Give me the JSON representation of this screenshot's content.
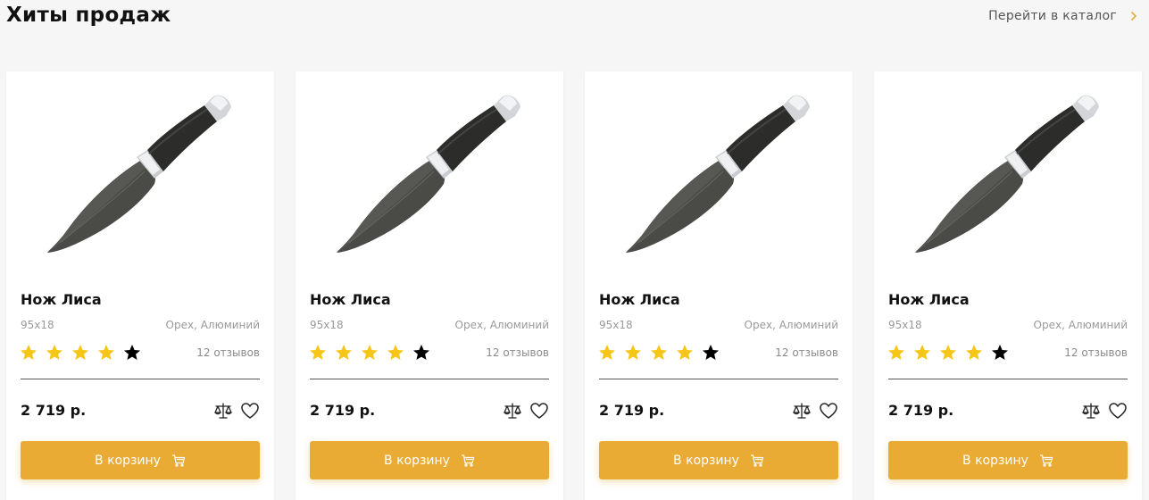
{
  "header": {
    "title": "Хиты продаж",
    "catalog_link": "Перейти в каталог"
  },
  "colors": {
    "accent": "#e9ab33",
    "star_filled": "#f5c518",
    "star_empty": "#000000"
  },
  "products": [
    {
      "name": "Нож Лиса",
      "size": "95х18",
      "material": "Орех, Алюминий",
      "rating": 4,
      "rating_max": 5,
      "reviews": "12 отзывов",
      "price": "2 719 р.",
      "button": "В корзину"
    },
    {
      "name": "Нож Лиса",
      "size": "95х18",
      "material": "Орех, Алюминий",
      "rating": 4,
      "rating_max": 5,
      "reviews": "12 отзывов",
      "price": "2 719 р.",
      "button": "В корзину"
    },
    {
      "name": "Нож Лиса",
      "size": "95х18",
      "material": "Орех, Алюминий",
      "rating": 4,
      "rating_max": 5,
      "reviews": "12 отзывов",
      "price": "2 719 р.",
      "button": "В корзину"
    },
    {
      "name": "Нож Лиса",
      "size": "95х18",
      "material": "Орех, Алюминий",
      "rating": 4,
      "rating_max": 5,
      "reviews": "12 отзывов",
      "price": "2 719 р.",
      "button": "В корзину"
    }
  ]
}
